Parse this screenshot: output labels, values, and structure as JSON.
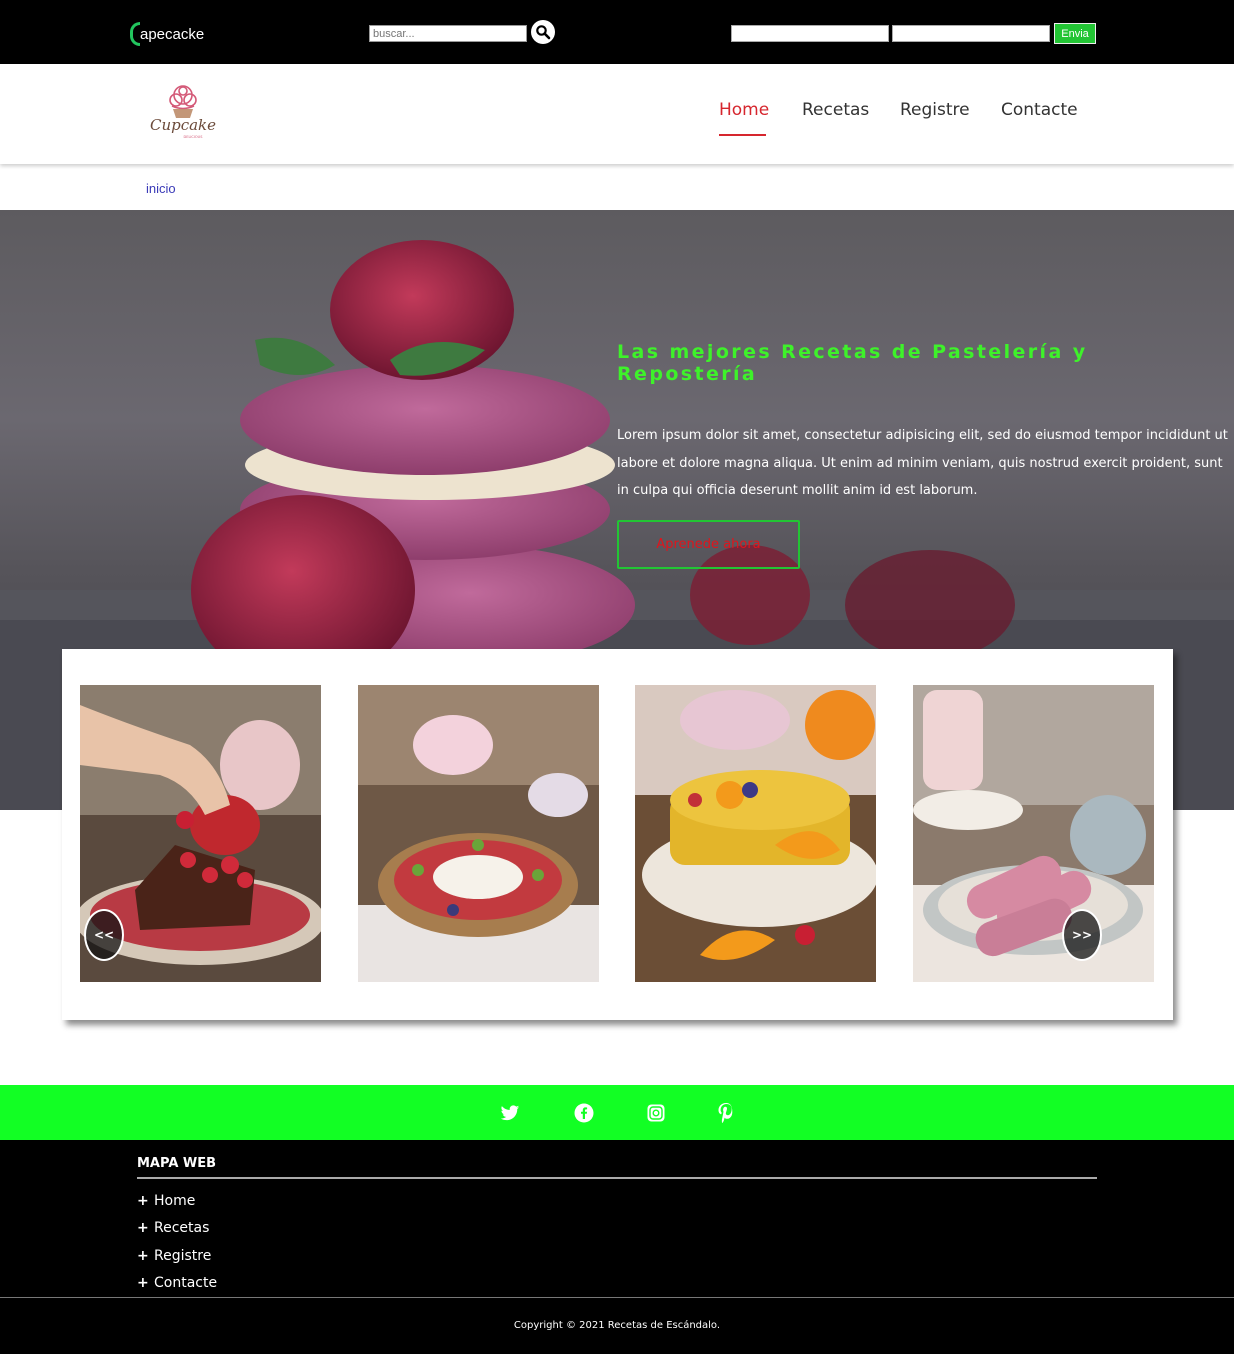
{
  "topbar": {
    "brand_text": "apecacke",
    "search_placeholder": "buscar...",
    "send_label": "Envia"
  },
  "logo": {
    "text": "Cupcake",
    "subtext": "DELICIOUS"
  },
  "nav": {
    "items": [
      {
        "label": "Home",
        "active": true
      },
      {
        "label": "Recetas",
        "active": false
      },
      {
        "label": "Registre",
        "active": false
      },
      {
        "label": "Contacte",
        "active": false
      }
    ]
  },
  "breadcrumb": "inicio",
  "hero": {
    "title": "Las mejores Recetas de Pastelería y Repostería",
    "text": "Lorem ipsum dolor sit amet, consectetur adipisicing elit, sed do eiusmod tempor incididunt ut labore et dolore magna aliqua. Ut enim ad minim veniam, quis nostrud exercit proident, sunt in culpa qui officia deserunt mollit anim id est laborum.",
    "button": "Aprenede ahora"
  },
  "carousel": {
    "prev": "<<",
    "next": ">>"
  },
  "social": [
    "twitter-icon",
    "facebook-icon",
    "instagram-icon",
    "pinterest-icon"
  ],
  "footer": {
    "map_title": "MAPA WEB",
    "links": [
      "Home",
      "Recetas",
      "Registre",
      "Contacte"
    ],
    "copyright": "Copyright © 2021 Recetas de Escándalo."
  },
  "colors": {
    "accent_green": "#12ff24",
    "nav_active": "#d6262e",
    "hero_title": "#3ef22a"
  }
}
